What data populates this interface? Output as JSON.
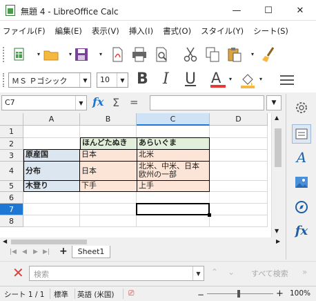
{
  "window": {
    "title": "無題 4 - LibreOffice Calc",
    "minimize_glyph": "—",
    "maximize_glyph": "☐",
    "close_glyph": "✕"
  },
  "menu": [
    "ファイル(F)",
    "編集(E)",
    "表示(V)",
    "挿入(I)",
    "書式(O)",
    "スタイル(Y)",
    "シート(S)"
  ],
  "formatting": {
    "font_name": "ＭＳ Ｐゴシック",
    "font_size": "10",
    "bold_label": "B",
    "italic_label": "I",
    "underline_label": "U",
    "font_color_label": "A",
    "accent_color": "#e53935"
  },
  "formula_bar": {
    "cell_ref": "C7",
    "fx_label": "fx",
    "sum_label": "Σ",
    "equals_label": "=",
    "content": ""
  },
  "grid": {
    "columns": [
      "A",
      "B",
      "C",
      "D"
    ],
    "active_column": "C",
    "rows": [
      "1",
      "2",
      "3",
      "4",
      "5",
      "6",
      "7",
      "8"
    ],
    "active_row": "7",
    "cells": {
      "B2": "ほんどたぬき",
      "C2": "あらいぐま",
      "A3": "原産国",
      "B3": "日本",
      "C3": "北米",
      "A4": "分布",
      "B4": "日本",
      "C4": "北米、中米、日本\n欧州の一部",
      "A5": "木登り",
      "B5": "下手",
      "C5": "上手"
    },
    "fill_colors": {
      "header": "#e2efda",
      "label": "#dce6f1",
      "data": "#fce4d6"
    }
  },
  "sheet_tabs": {
    "add_label": "+",
    "tabs": [
      "Sheet1"
    ]
  },
  "find_bar": {
    "placeholder": "検索",
    "find_all_label": "すべて検索"
  },
  "status_bar": {
    "sheet_position": "シート 1 / 1",
    "page_style": "標準",
    "language": "英語 (米国)",
    "zoom": "100%"
  }
}
